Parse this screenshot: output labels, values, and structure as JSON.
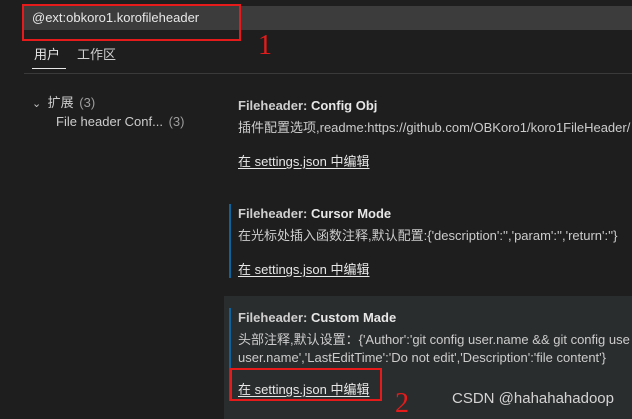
{
  "search": {
    "value": "@ext:obkoro1.korofileheader"
  },
  "tabs": [
    {
      "label": "用户",
      "active": true
    },
    {
      "label": "工作区",
      "active": false
    }
  ],
  "tree": {
    "root": {
      "label": "扩展",
      "count": "(3)"
    },
    "child": {
      "label": "File header Conf...",
      "count": "(3)"
    }
  },
  "settings": [
    {
      "category": "Fileheader: ",
      "name": "Config Obj",
      "description": [
        "插件配置选项,readme:https://github.com/OBKoro1/koro1FileHeader/"
      ],
      "link": "在 settings.json 中编辑"
    },
    {
      "category": "Fileheader: ",
      "name": "Cursor Mode",
      "description": [
        "在光标处插入函数注释,默认配置:{'description':'','param':'','return':''}"
      ],
      "link": "在 settings.json 中编辑"
    },
    {
      "category": "Fileheader: ",
      "name": "Custom Made",
      "description": [
        "头部注释,默认设置：{'Author':'git config user.name && git config use",
        "user.name','LastEditTime':'Do not edit','Description':'file content'}"
      ],
      "link": "在 settings.json 中编辑"
    }
  ],
  "annotations": {
    "first": "1",
    "second": "2"
  },
  "watermark": "CSDN @hahahahadoop",
  "colors": {
    "background": "#1e1e1e",
    "accent": "#0e639c",
    "annotation": "#e51b1b"
  }
}
